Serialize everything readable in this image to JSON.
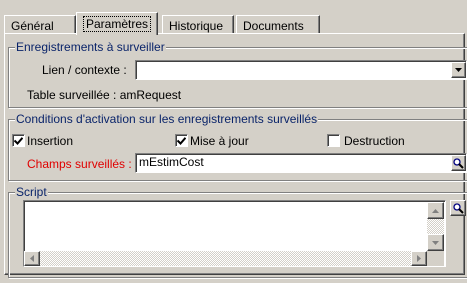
{
  "tabs": [
    {
      "label": "Général",
      "active": false
    },
    {
      "label": "Paramètres",
      "active": true
    },
    {
      "label": "Historique",
      "active": false
    },
    {
      "label": "Documents",
      "active": false
    }
  ],
  "group_records": {
    "legend": "Enregistrements à surveiller",
    "link_label": "Lien / contexte :",
    "link_value": "",
    "table_label": "Table surveillée : amRequest"
  },
  "group_conditions": {
    "legend": "Conditions d'activation sur les enregistrements surveillés",
    "checkboxes": [
      {
        "label": "Insertion",
        "checked": true
      },
      {
        "label": "Mise à jour",
        "checked": true
      },
      {
        "label": "Destruction",
        "checked": false
      }
    ],
    "fields_label": "Champs surveillés :",
    "fields_value": "mEstimCost"
  },
  "group_script": {
    "legend": "Script",
    "content": ""
  },
  "colors": {
    "face": "#d4d0c8",
    "legend": "#0a246a",
    "required_label": "#e00000"
  }
}
